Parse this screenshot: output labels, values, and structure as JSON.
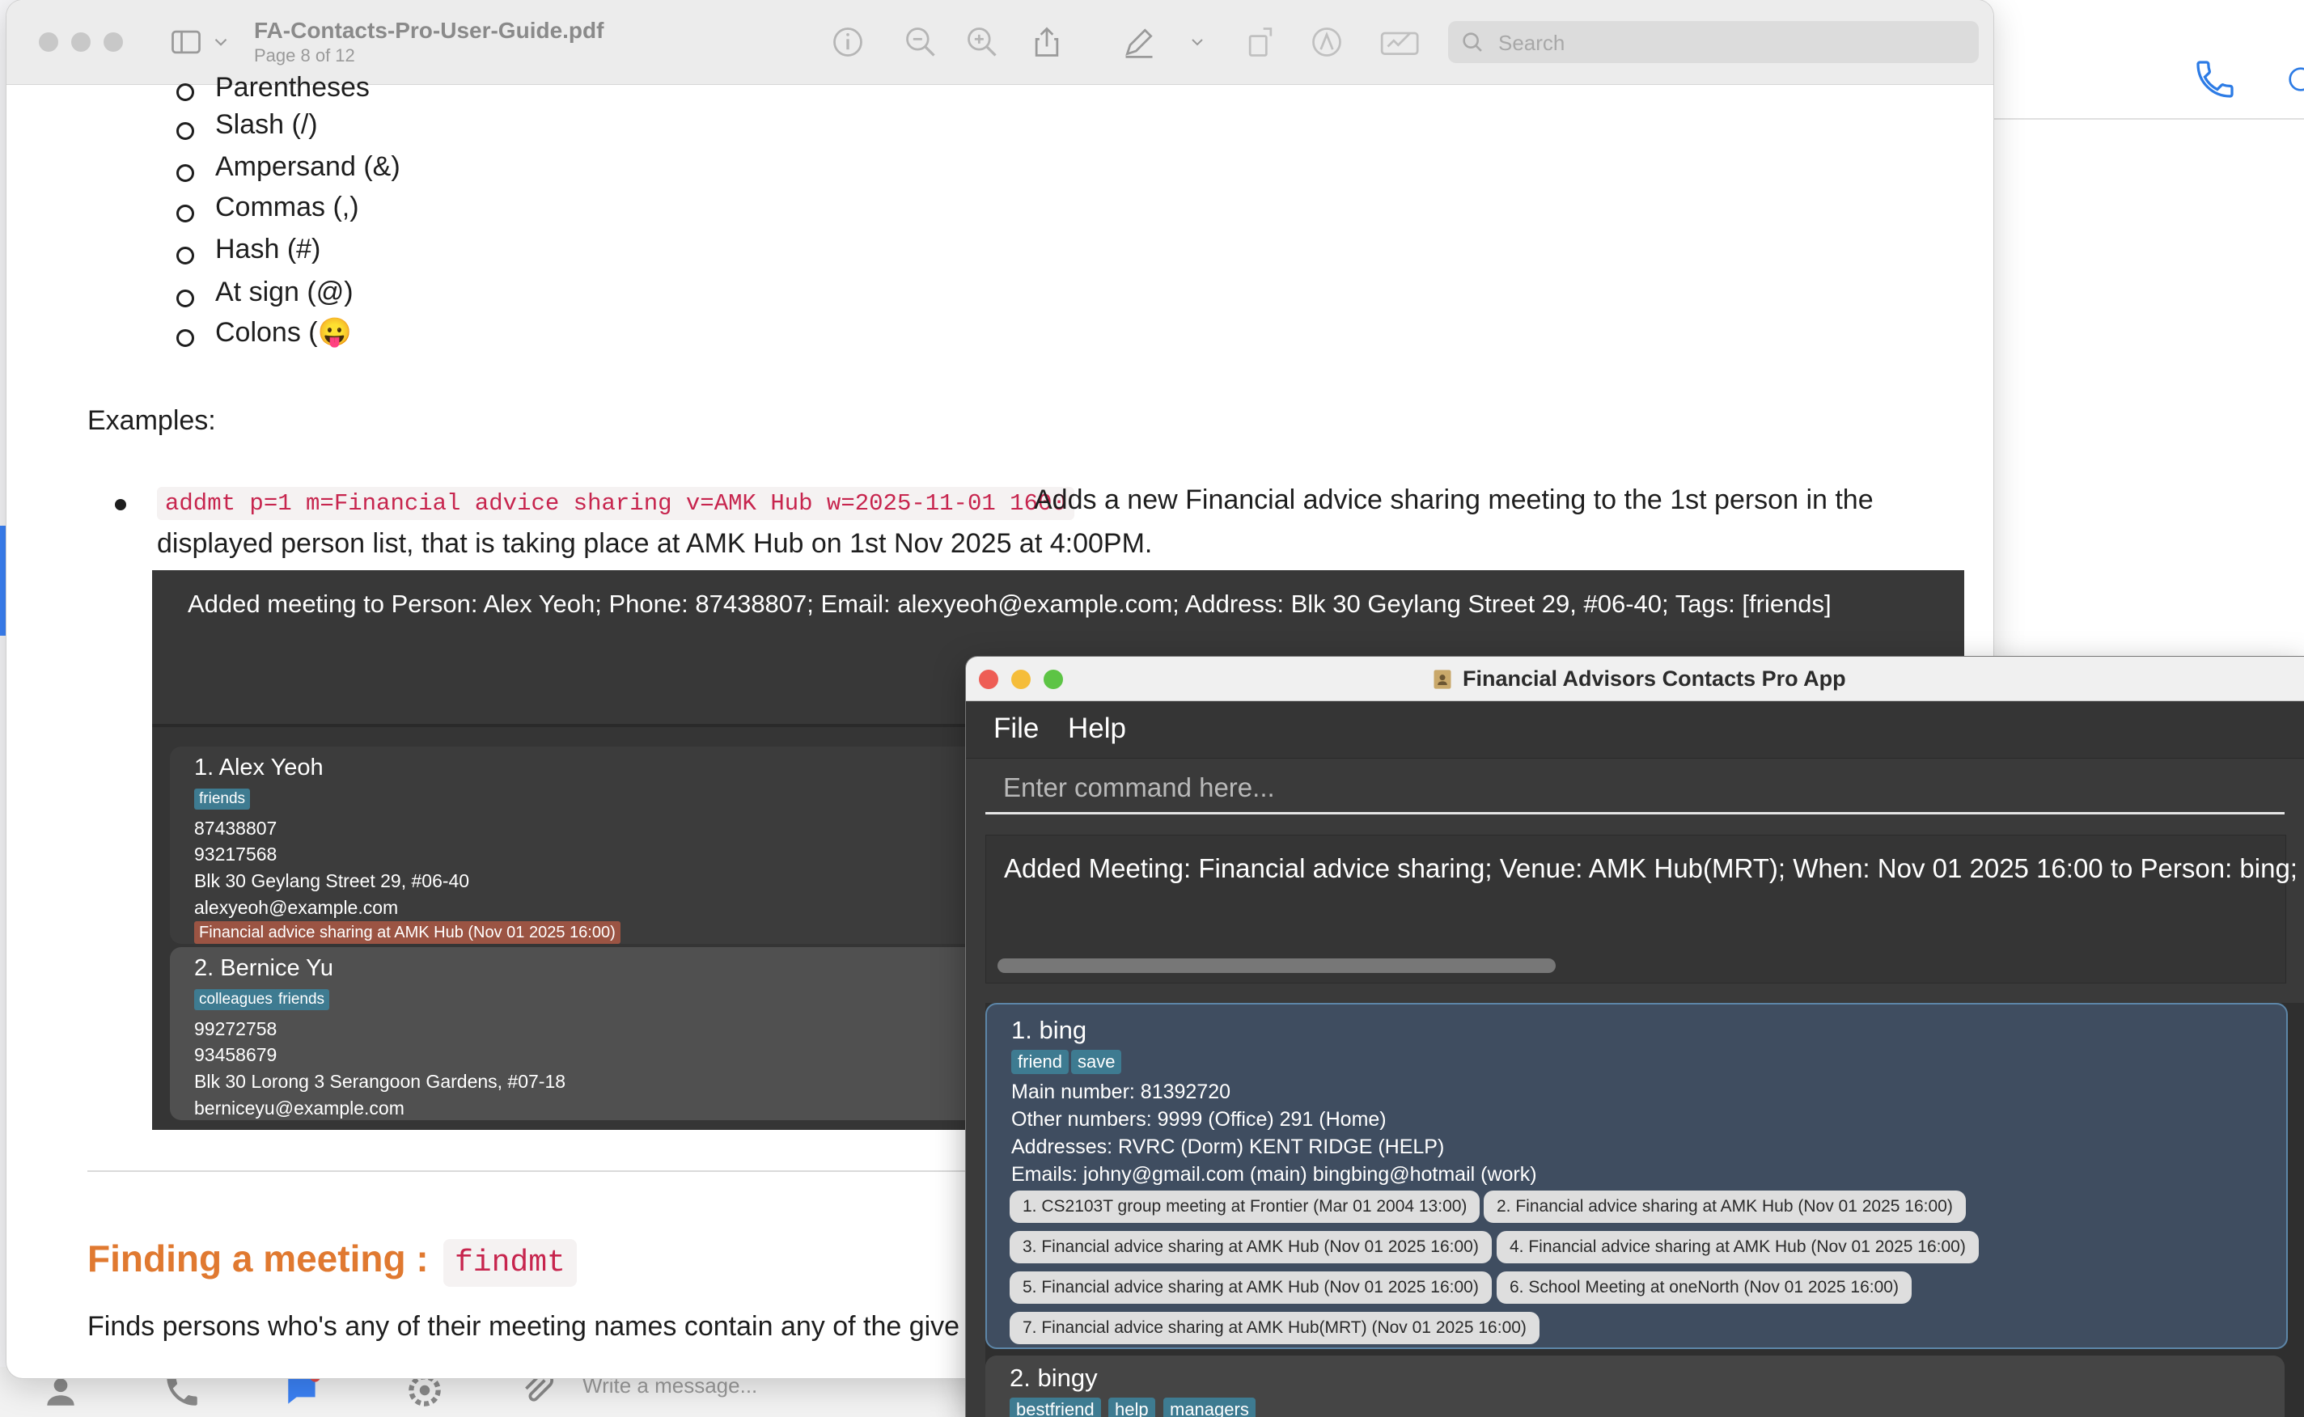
{
  "pdf": {
    "filename": "FA-Contacts-Pro-User-Guide.pdf",
    "page_info": "Page 8 of 12",
    "search_placeholder": "Search",
    "symbols": [
      "Parentheses",
      "Slash (/)",
      "Ampersand (&)",
      "Commas (,)",
      "Hash (#)",
      "At sign (@)",
      "Colons (😛"
    ],
    "examples_label": "Examples:",
    "example": {
      "code": "addmt p=1 m=Financial advice sharing v=AMK Hub w=2025-11-01 1600",
      "desc_line1": "Adds a new Financial advice sharing meeting to the 1st person in the",
      "desc_line2": "displayed person list, that is taking place at AMK Hub on 1st Nov 2025 at 4:00PM."
    },
    "embedded": {
      "result": "Added meeting to Person: Alex Yeoh; Phone: 87438807; Email: alexyeoh@example.com; Address: Blk 30 Geylang Street 29, #06-40; Tags: [friends]",
      "persons": [
        {
          "name": "1. Alex Yeoh",
          "tags": [
            "friends"
          ],
          "phone1": "87438807",
          "phone2": "93217568",
          "address": "Blk 30 Geylang Street 29, #06-40",
          "email": "alexyeoh@example.com",
          "meeting": "Financial advice sharing at AMK Hub (Nov 01 2025 16:00)"
        },
        {
          "name": "2. Bernice Yu",
          "tags": [
            "colleagues",
            "friends"
          ],
          "phone1": "99272758",
          "phone2": "93458679",
          "address": "Blk 30 Lorong 3 Serangoon Gardens, #07-18",
          "email": "berniceyu@example.com"
        }
      ]
    },
    "section_heading": "Finding a meeting :",
    "section_code": "findmt",
    "section_desc": "Finds persons who's any of their meeting names contain any of the give"
  },
  "fa_app": {
    "title": "Financial Advisors Contacts Pro App",
    "menu": [
      "File",
      "Help"
    ],
    "command_placeholder": "Enter command here...",
    "result": "Added Meeting: Financial advice sharing; Venue: AMK Hub(MRT); When: Nov 01 2025 16:00 to Person: bing; P",
    "persons": [
      {
        "name": "1. bing",
        "tags": [
          "friend",
          "save"
        ],
        "main_number": "Main number:  81392720",
        "other_numbers": "Other numbers:  9999 (Office) 291 (Home)",
        "addresses": "Addresses:  RVRC (Dorm) KENT RIDGE (HELP)",
        "emails": "Emails:  johny@gmail.com (main) bingbing@hotmail (work)",
        "meetings": [
          "1. CS2103T group meeting at Frontier (Mar 01 2004 13:00)",
          "2. Financial advice sharing at AMK Hub (Nov 01 2025 16:00)",
          "3. Financial advice sharing at AMK Hub (Nov 01 2025 16:00)",
          "4. Financial advice sharing at AMK Hub (Nov 01 2025 16:00)",
          "5. Financial advice sharing at AMK Hub (Nov 01 2025 16:00)",
          "6. School Meeting at oneNorth (Nov 01 2025 16:00)",
          "7. Financial advice sharing at AMK Hub(MRT) (Nov 01 2025 16:00)"
        ]
      },
      {
        "name": "2. bingy",
        "tags": [
          "bestfriend",
          "help",
          "managers"
        ]
      }
    ]
  },
  "messenger": {
    "message_placeholder": "Write a message..."
  }
}
